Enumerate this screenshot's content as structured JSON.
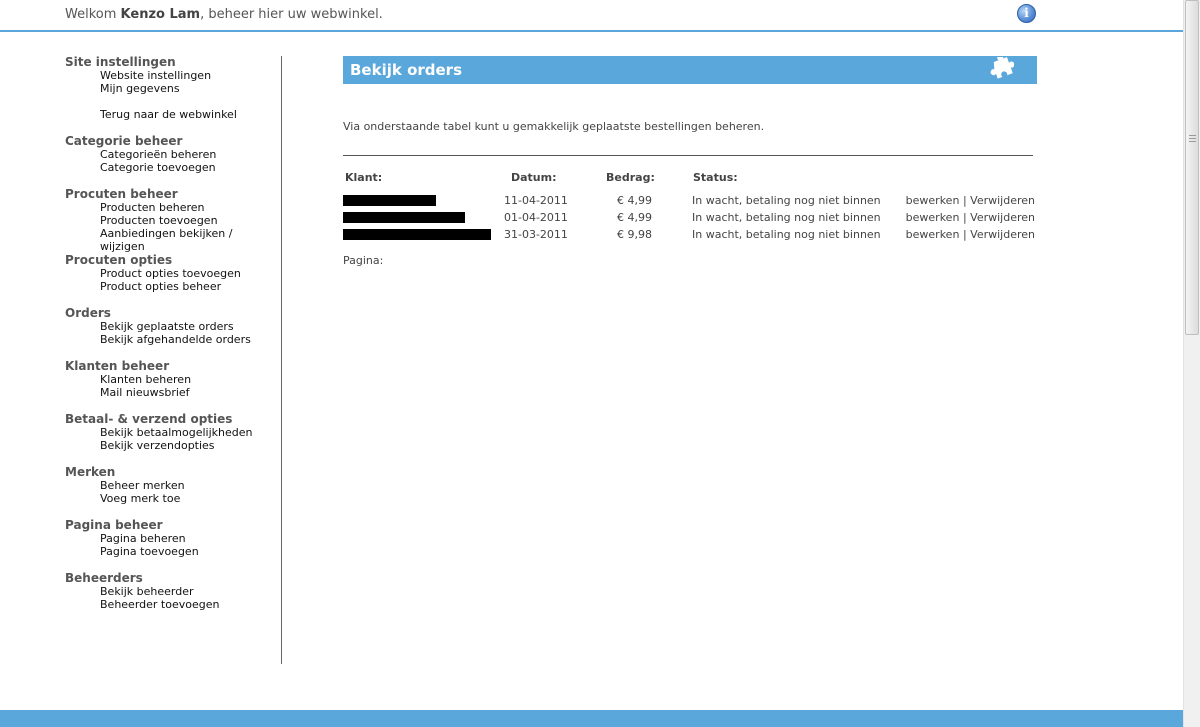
{
  "header": {
    "welcome_prefix": "Welkom",
    "user_name": "Kenzo Lam",
    "welcome_suffix": ", beheer hier uw webwinkel.",
    "info_glyph": "i"
  },
  "sidebar": {
    "sections": [
      {
        "heading": "Site instellingen",
        "items": [
          "Website instellingen",
          "Mijn gegevens"
        ],
        "extra": "Terug naar de webwinkel"
      },
      {
        "heading": "Categorie beheer",
        "items": [
          "Categorieën beheren",
          "Categorie toevoegen"
        ]
      },
      {
        "heading": "Procuten beheer",
        "items": [
          "Producten beheren",
          "Producten toevoegen",
          "Aanbiedingen bekijken / wijzigen"
        ]
      },
      {
        "heading": "Procuten opties",
        "items": [
          "Product opties toevoegen",
          "Product opties beheer"
        ]
      },
      {
        "heading": "Orders",
        "items": [
          "Bekijk geplaatste orders",
          "Bekijk afgehandelde orders"
        ]
      },
      {
        "heading": "Klanten beheer",
        "items": [
          "Klanten beheren",
          "Mail nieuwsbrief"
        ]
      },
      {
        "heading": "Betaal- & verzend opties",
        "items": [
          "Bekijk betaalmogelijkheden",
          "Bekijk verzendopties"
        ]
      },
      {
        "heading": "Merken",
        "items": [
          "Beheer merken",
          "Voeg merk toe"
        ]
      },
      {
        "heading": "Pagina beheer",
        "items": [
          "Pagina beheren",
          "Pagina toevoegen"
        ]
      },
      {
        "heading": "Beheerders",
        "items": [
          "Bekijk beheerder",
          "Beheerder toevoegen"
        ]
      }
    ]
  },
  "main": {
    "title": "Bekijk orders",
    "intro": "Via onderstaande tabel kunt u gemakkelijk geplaatste bestellingen beheren.",
    "columns": {
      "client": "Klant:",
      "date": "Datum:",
      "amount": "Bedrag:",
      "status": "Status:"
    },
    "orders": [
      {
        "date": "11-04-2011",
        "amount": "€ 4,99",
        "status": "In wacht, betaling nog niet binnen",
        "edit": "bewerken",
        "separator": "|",
        "delete": "Verwijderen"
      },
      {
        "date": "01-04-2011",
        "amount": "€ 4,99",
        "status": "In wacht, betaling nog niet binnen",
        "edit": "bewerken",
        "separator": "|",
        "delete": "Verwijderen"
      },
      {
        "date": "31-03-2011",
        "amount": "€ 9,98",
        "status": "In wacht, betaling nog niet binnen",
        "edit": "bewerken",
        "separator": "|",
        "delete": "Verwijderen"
      }
    ],
    "pager_label": "Pagina:"
  },
  "colors": {
    "accent": "#5aa7dc",
    "redaction": "#000000"
  }
}
